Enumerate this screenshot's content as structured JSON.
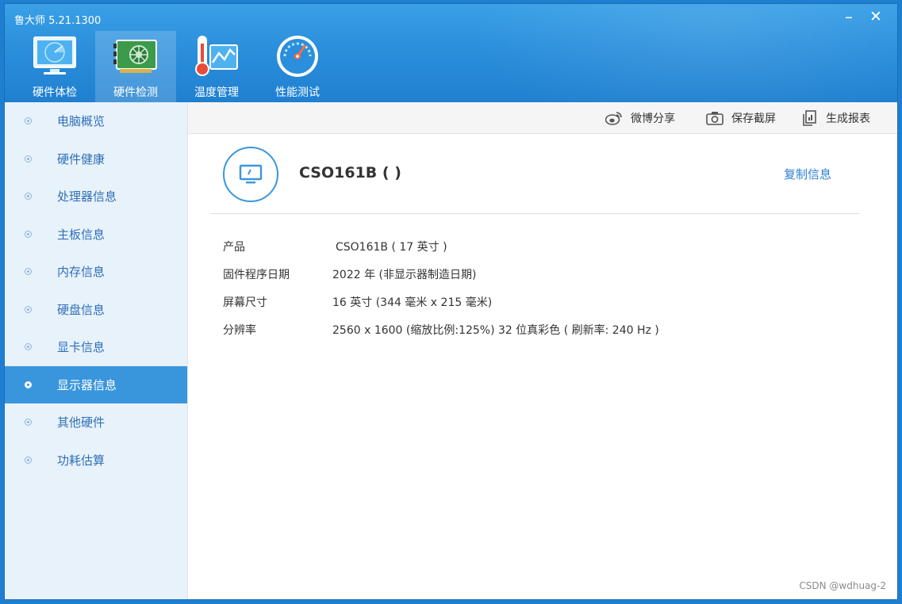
{
  "app": {
    "title": "鲁大师 5.21.1300",
    "minimize_label": "–",
    "close_label": "✕"
  },
  "tabs": [
    {
      "label": "硬件体检",
      "icon": "monitor-radar-icon",
      "active": false
    },
    {
      "label": "硬件检测",
      "icon": "circuit-board-icon",
      "active": true
    },
    {
      "label": "温度管理",
      "icon": "thermometer-chart-icon",
      "active": false
    },
    {
      "label": "性能测试",
      "icon": "speedometer-icon",
      "active": false
    }
  ],
  "sidebar": {
    "items": [
      {
        "label": "电脑概览"
      },
      {
        "label": "硬件健康"
      },
      {
        "label": "处理器信息"
      },
      {
        "label": "主板信息"
      },
      {
        "label": "内存信息"
      },
      {
        "label": "硬盘信息"
      },
      {
        "label": "显卡信息"
      },
      {
        "label": "显示器信息",
        "active": true
      },
      {
        "label": "其他硬件"
      },
      {
        "label": "功耗估算"
      }
    ]
  },
  "toolbar": {
    "weibo_label": "微博分享",
    "screenshot_label": "保存截屏",
    "report_label": "生成报表"
  },
  "device": {
    "title": "CSO161B ( )",
    "copy_label": "复制信息"
  },
  "details": [
    {
      "key": "产品",
      "value": "CSO161B ( 17 英寸 )"
    },
    {
      "key": "固件程序日期",
      "value": "2022 年 (非显示器制造日期)"
    },
    {
      "key": "屏幕尺寸",
      "value": "16 英寸 (344 毫米 x 215 毫米)"
    },
    {
      "key": "分辨率",
      "value": "2560 x 1600 (缩放比例:125%) 32 位真彩色 ( 刷新率: 240 Hz )"
    }
  ],
  "watermark": "CSDN @wdhuag-2",
  "colors": {
    "accent": "#3a96dc",
    "header": "#2b8fdc",
    "sidebar_bg": "#e8f2fb",
    "sidebar_text": "#2f6fb6",
    "link": "#2f80d0"
  }
}
